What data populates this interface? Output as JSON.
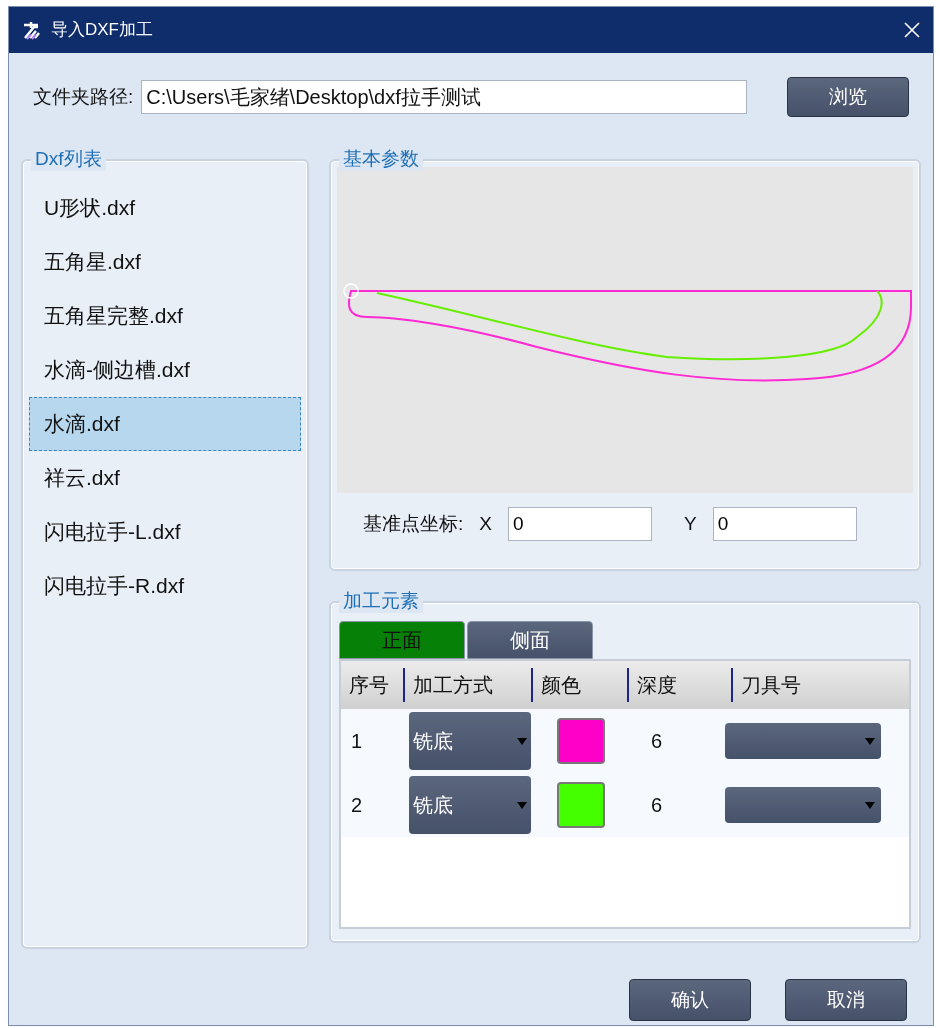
{
  "window": {
    "title": "导入DXF加工"
  },
  "path": {
    "label": "文件夹路径:",
    "value": "C:\\Users\\毛家绪\\Desktop\\dxf拉手测试",
    "browse": "浏览"
  },
  "dxf_list": {
    "title": "Dxf列表",
    "items": [
      {
        "label": "U形状.dxf",
        "selected": false
      },
      {
        "label": "五角星.dxf",
        "selected": false
      },
      {
        "label": "五角星完整.dxf",
        "selected": false
      },
      {
        "label": "水滴-侧边槽.dxf",
        "selected": false
      },
      {
        "label": "水滴.dxf",
        "selected": true
      },
      {
        "label": "祥云.dxf",
        "selected": false
      },
      {
        "label": "闪电拉手-L.dxf",
        "selected": false
      },
      {
        "label": "闪电拉手-R.dxf",
        "selected": false
      }
    ]
  },
  "basic_params": {
    "title": "基本参数",
    "origin_label": "基准点坐标:",
    "x_label": "X",
    "x_value": "0",
    "y_label": "Y",
    "y_value": "0"
  },
  "elements": {
    "title": "加工元素",
    "tabs": [
      {
        "label": "正面",
        "selected": true
      },
      {
        "label": "侧面",
        "selected": false
      }
    ],
    "columns": [
      "序号",
      "加工方式",
      "颜色",
      "深度",
      "刀具号"
    ],
    "rows": [
      {
        "index": "1",
        "method": "铣底",
        "color": "#ff00c8",
        "depth": "6"
      },
      {
        "index": "2",
        "method": "铣底",
        "color": "#44ff00",
        "depth": "6"
      }
    ]
  },
  "buttons": [
    "确认",
    "取消"
  ]
}
